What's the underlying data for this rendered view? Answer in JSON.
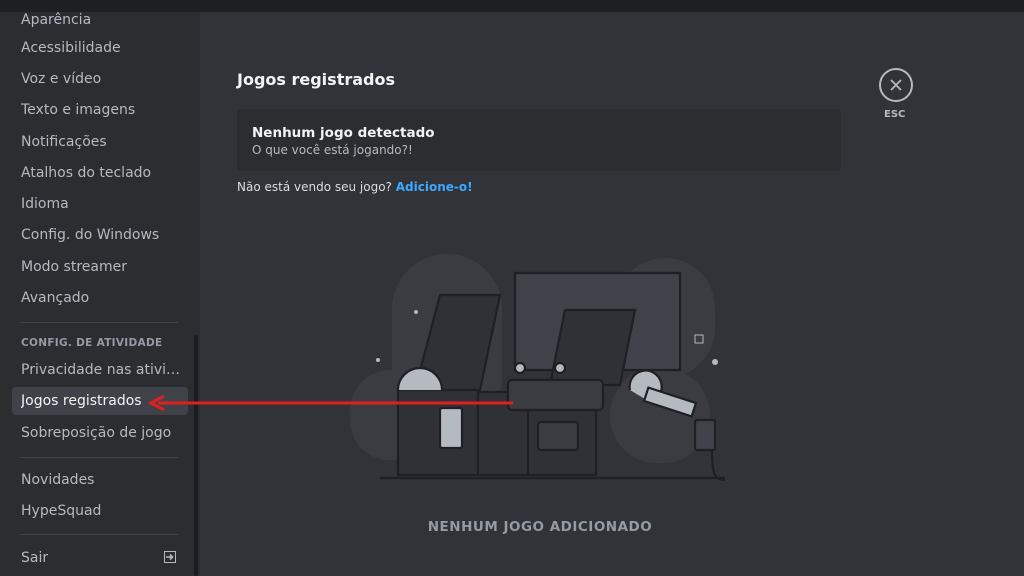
{
  "sidebar": {
    "items": [
      {
        "label": "Aparência"
      },
      {
        "label": "Acessibilidade"
      },
      {
        "label": "Voz e vídeo"
      },
      {
        "label": "Texto e imagens"
      },
      {
        "label": "Notificações"
      },
      {
        "label": "Atalhos do teclado"
      },
      {
        "label": "Idioma"
      },
      {
        "label": "Config. do Windows"
      },
      {
        "label": "Modo streamer"
      },
      {
        "label": "Avançado"
      }
    ],
    "activity_header": "CONFIG. DE ATIVIDADE",
    "activity_items": [
      {
        "label": "Privacidade nas atividades"
      },
      {
        "label": "Jogos registrados"
      },
      {
        "label": "Sobreposição de jogo"
      }
    ],
    "extra_items": [
      {
        "label": "Novidades"
      },
      {
        "label": "HypeSquad"
      }
    ],
    "logout_label": "Sair"
  },
  "main": {
    "title": "Jogos registrados",
    "detect_title": "Nenhum jogo detectado",
    "detect_sub": "O que você está jogando?!",
    "add_prompt": "Não está vendo seu jogo?",
    "add_link": "Adicione-o!",
    "empty_state": "NENHUM JOGO ADICIONADO"
  },
  "close": {
    "label": "ESC"
  },
  "colors": {
    "accent_link": "#3ea8ff",
    "annotation_arrow": "#e02020",
    "active_item_bg": "#404249"
  }
}
